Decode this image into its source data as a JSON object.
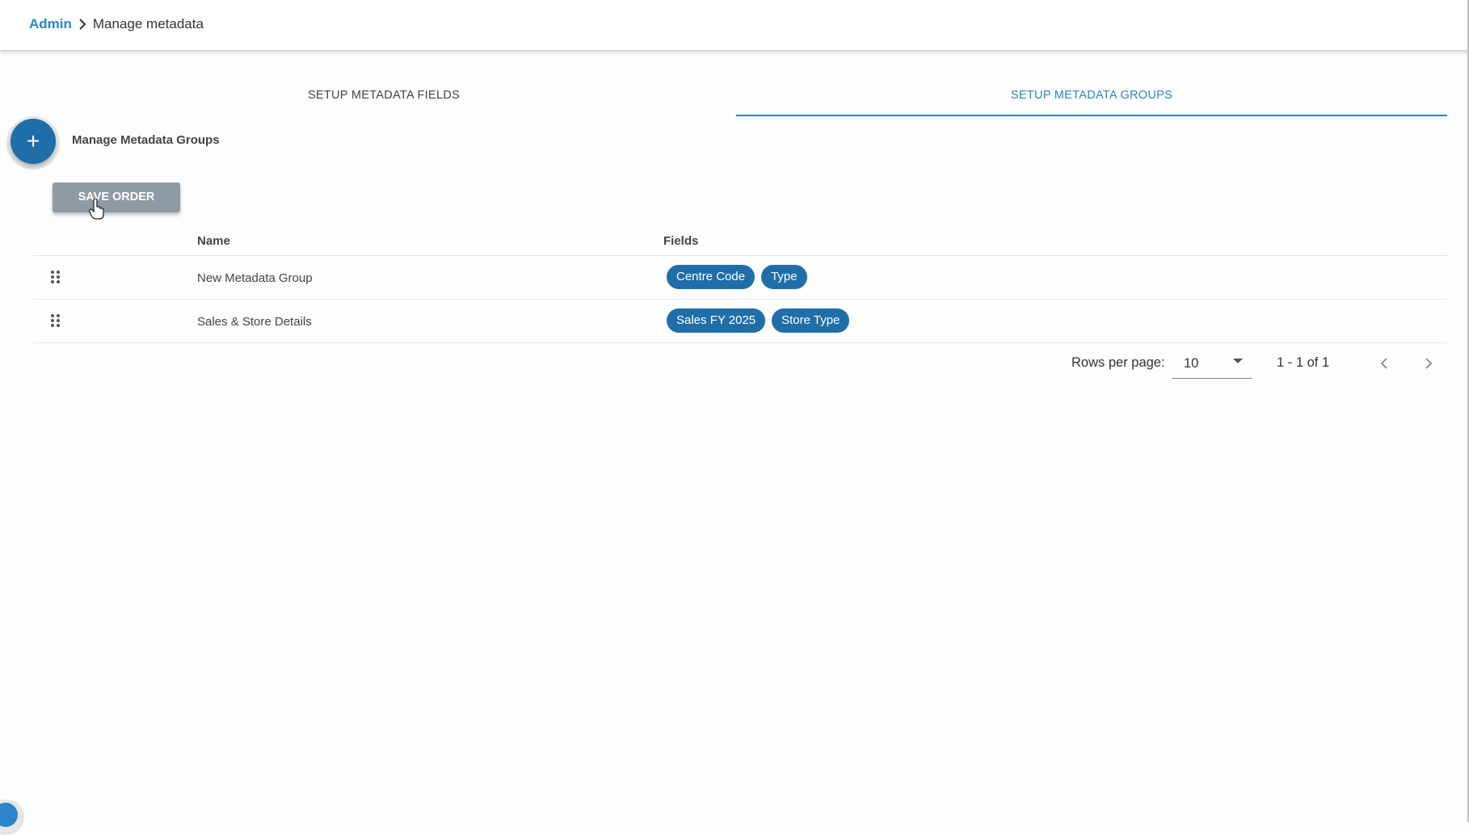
{
  "breadcrumb": {
    "root": "Admin",
    "current": "Manage metadata"
  },
  "tabs": [
    {
      "label": "SETUP METADATA FIELDS",
      "active": false
    },
    {
      "label": "SETUP METADATA GROUPS",
      "active": true
    }
  ],
  "fab": {
    "icon": "+"
  },
  "section_title": "Manage Metadata Groups",
  "save_button": "SAVE ORDER",
  "table": {
    "columns": {
      "name": "Name",
      "fields": "Fields"
    },
    "rows": [
      {
        "name": "New Metadata Group",
        "fields": [
          "Centre Code",
          "Type"
        ]
      },
      {
        "name": "Sales & Store Details",
        "fields": [
          "Sales FY 2025",
          "Store Type"
        ]
      }
    ]
  },
  "pagination": {
    "rows_per_page_label": "Rows per page:",
    "rows_per_page_value": "10",
    "range": "1 - 1 of 1"
  },
  "colors": {
    "accent": "#2a86c9",
    "chip": "#1f6ea8",
    "save_button": "#8f9aa4"
  }
}
